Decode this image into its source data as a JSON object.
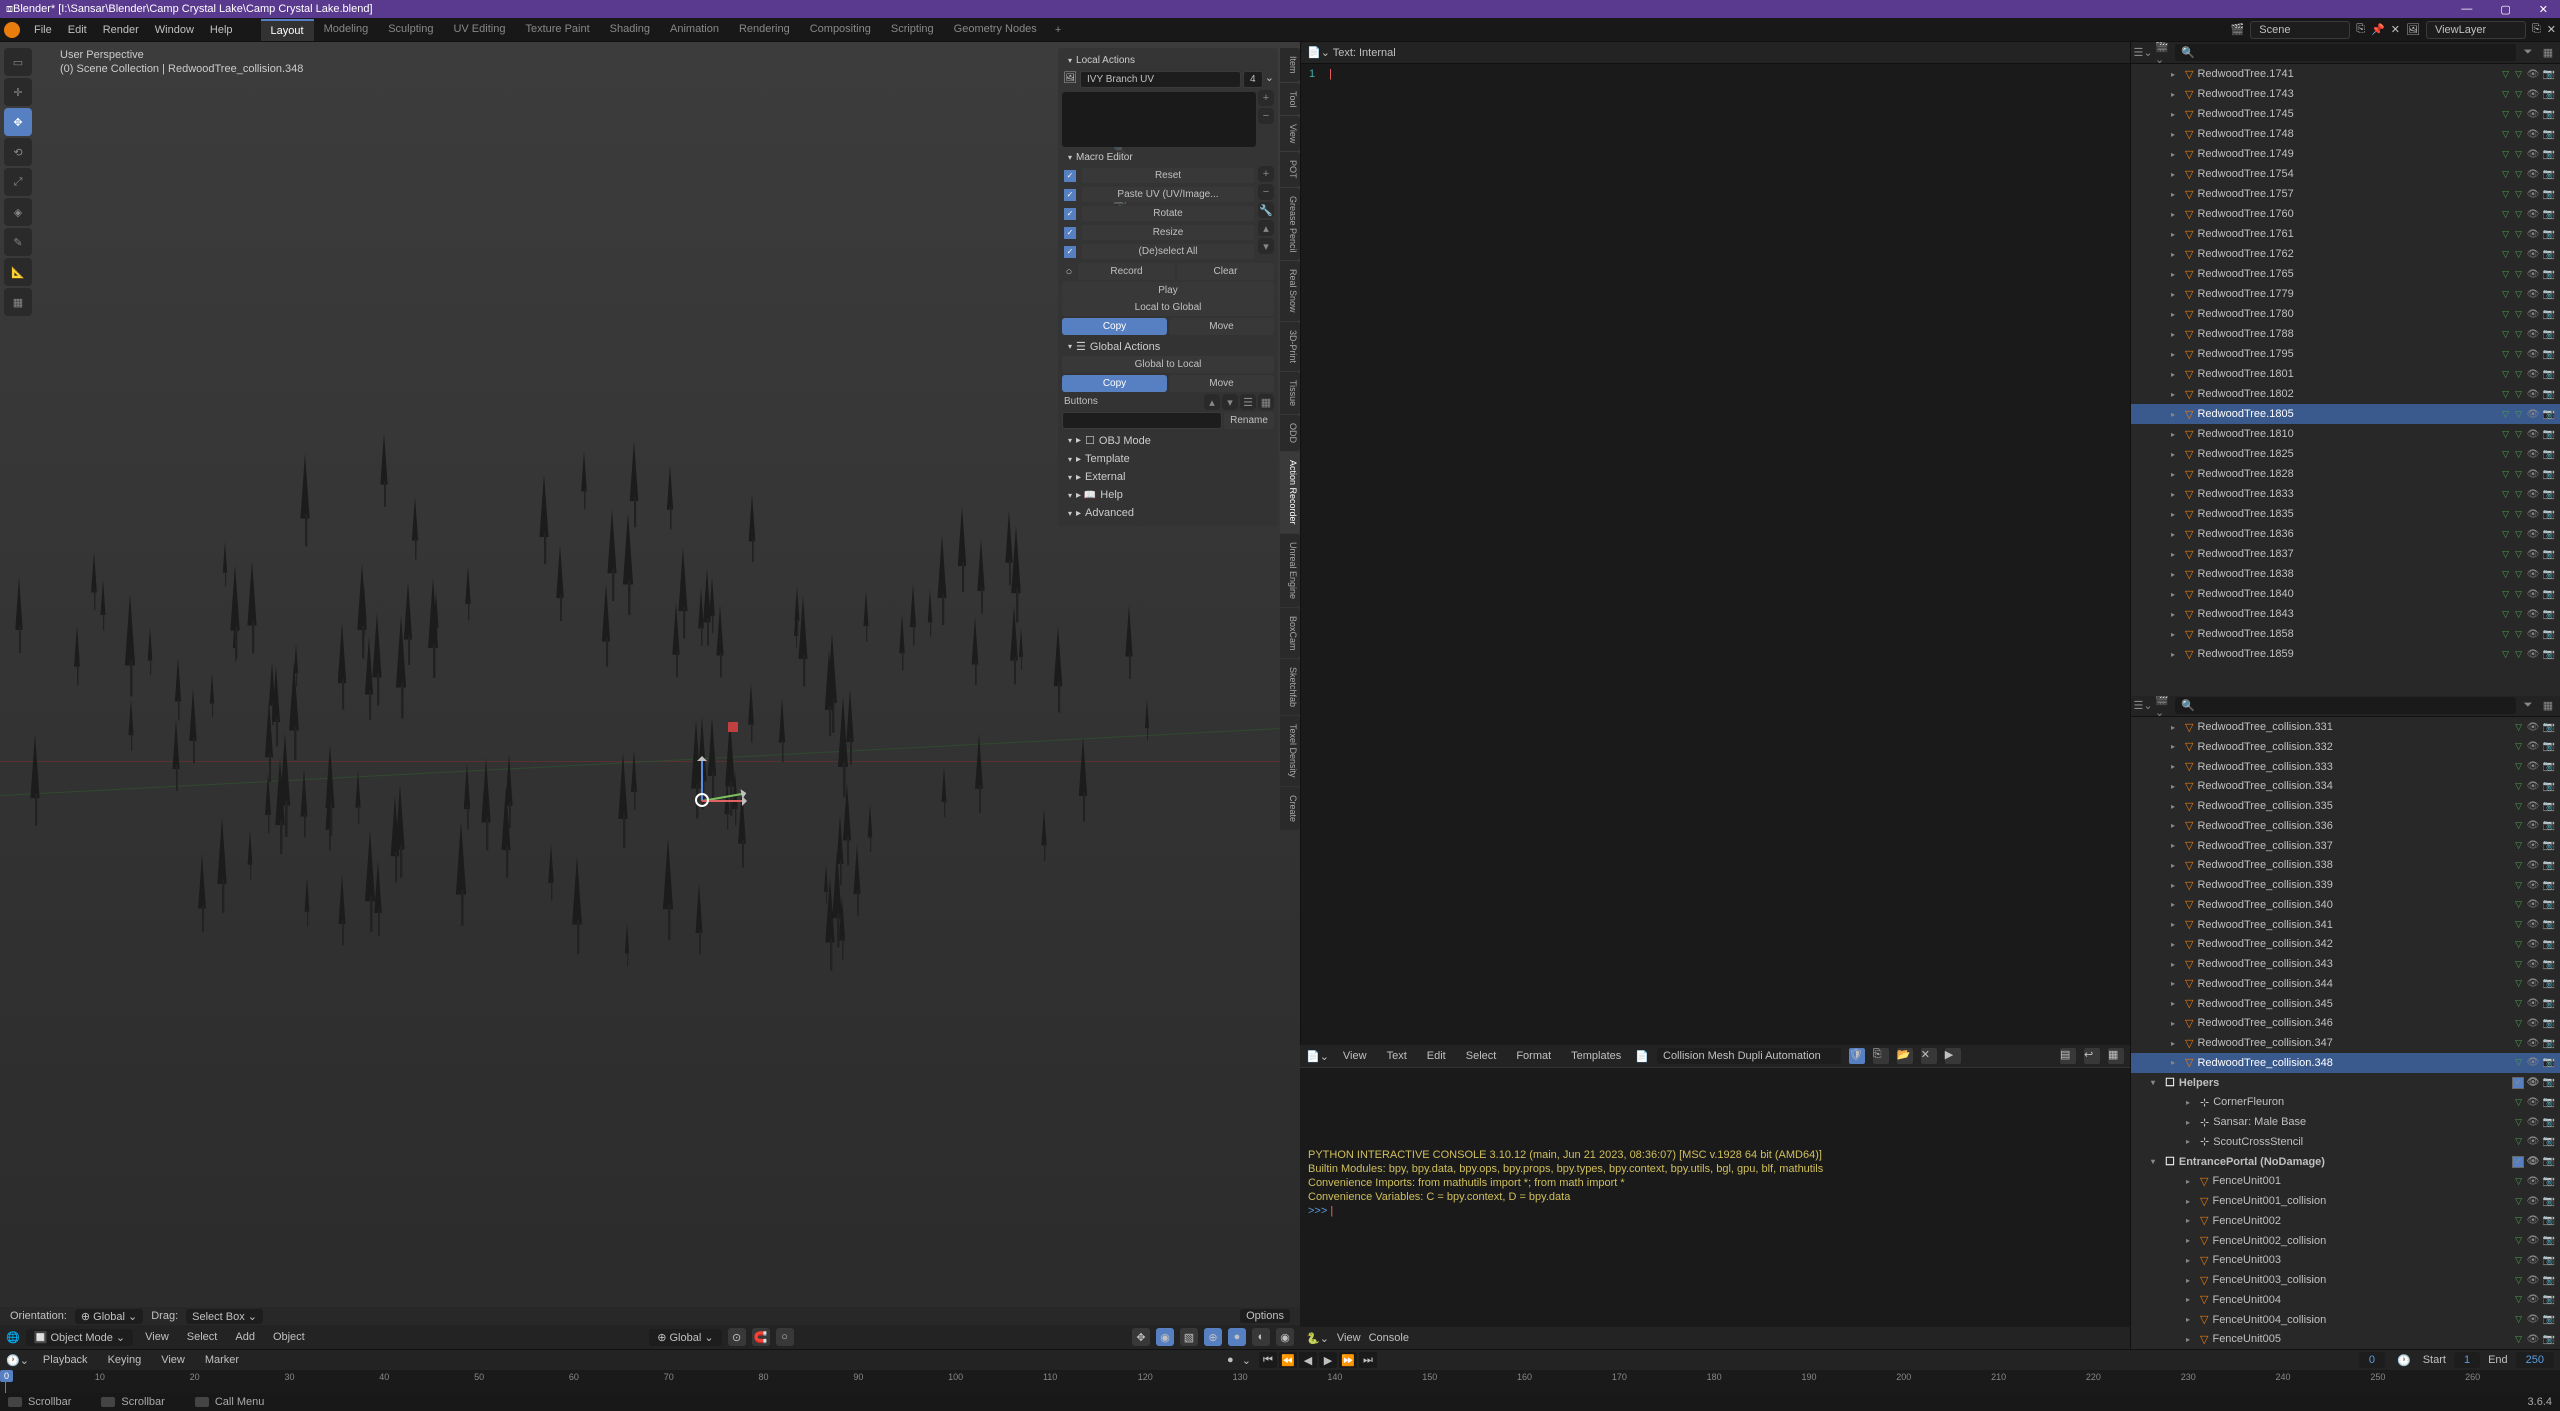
{
  "title_bar": {
    "title": "Blender* [I:\\Sansar\\Blender\\Camp Crystal Lake\\Camp Crystal Lake.blend]"
  },
  "top_menu": {
    "items": [
      "File",
      "Edit",
      "Render",
      "Window",
      "Help"
    ],
    "workspaces": [
      "Layout",
      "Modeling",
      "Sculpting",
      "UV Editing",
      "Texture Paint",
      "Shading",
      "Animation",
      "Rendering",
      "Compositing",
      "Scripting",
      "Geometry Nodes"
    ],
    "active_workspace": 0,
    "scene": "Scene",
    "viewlayer": "ViewLayer"
  },
  "viewport": {
    "info_line1": "User Perspective",
    "info_line2": "(0) Scene Collection | RedwoodTree_collision.348",
    "orientation_label": "Orientation:",
    "orientation_value": "Global",
    "drag_label": "Drag:",
    "drag_value": "Select Box",
    "options_label": "Options",
    "mode": "Object Mode",
    "mode_menus": [
      "View",
      "Select",
      "Add",
      "Object"
    ],
    "global": "Global"
  },
  "n_panel": {
    "local_actions": "Local Actions",
    "macro_editor": "Macro Editor",
    "global_actions": "Global Actions",
    "uv_name": "IVY Branch UV",
    "uv_count": "4",
    "macros": [
      {
        "label": "Reset"
      },
      {
        "label": "Paste UV (UV/Image..."
      },
      {
        "label": "Rotate"
      },
      {
        "label": "Resize"
      },
      {
        "label": "(De)select All"
      }
    ],
    "record": "Record",
    "clear": "Clear",
    "play": "Play",
    "local_to_global": "Local to Global",
    "copy": "Copy",
    "move": "Move",
    "global_to_local": "Global to Local",
    "buttons_label": "Buttons",
    "rename": "Rename",
    "obj_mode": "OBJ Mode",
    "template": "Template",
    "external": "External",
    "help": "Help",
    "advanced": "Advanced",
    "tabs": [
      "Item",
      "Tool",
      "View",
      "POT",
      "Grease Pencil",
      "Real Snow",
      "3D-Print",
      "Tissue",
      "ODD",
      "Action Recorder",
      "Unreal Engine",
      "BoxCam",
      "Sketchfab",
      "Texel Density",
      "Create"
    ]
  },
  "text_editor": {
    "header": "Text: Internal",
    "menus": [
      "View",
      "Text",
      "Edit",
      "Select",
      "Format",
      "Templates"
    ],
    "name": "Collision Mesh Dupli Automation"
  },
  "console": {
    "lines": [
      "PYTHON INTERACTIVE CONSOLE 3.10.12 (main, Jun 21 2023, 08:36:07) [MSC v.1928 64 bit (AMD64)]",
      "",
      "Builtin Modules:       bpy, bpy.data, bpy.ops, bpy.props, bpy.types, bpy.context, bpy.utils, bgl, gpu, blf, mathutils",
      "Convenience Imports:   from mathutils import *; from math import *",
      "Convenience Variables: C = bpy.context, D = bpy.data"
    ],
    "prompt": ">>>",
    "menus": [
      "View",
      "Console"
    ]
  },
  "timeline": {
    "menus": [
      "Playback",
      "Keying",
      "View",
      "Marker"
    ],
    "current": "0",
    "start_label": "Start",
    "start": "1",
    "end_label": "End",
    "end": "250",
    "ticks": [
      "10",
      "20",
      "30",
      "40",
      "50",
      "60",
      "70",
      "80",
      "90",
      "100",
      "110",
      "120",
      "130",
      "140",
      "150",
      "160",
      "170",
      "180",
      "190",
      "200",
      "210",
      "220",
      "230",
      "240",
      "250",
      "260"
    ]
  },
  "status": {
    "scrollbar1": "Scrollbar",
    "scrollbar2": "Scrollbar",
    "callmenu": "Call Menu",
    "version": "3.6.4"
  },
  "outliner_top": {
    "items": [
      {
        "name": "RedwoodTree.1741"
      },
      {
        "name": "RedwoodTree.1743"
      },
      {
        "name": "RedwoodTree.1745"
      },
      {
        "name": "RedwoodTree.1748"
      },
      {
        "name": "RedwoodTree.1749"
      },
      {
        "name": "RedwoodTree.1754"
      },
      {
        "name": "RedwoodTree.1757"
      },
      {
        "name": "RedwoodTree.1760"
      },
      {
        "name": "RedwoodTree.1761"
      },
      {
        "name": "RedwoodTree.1762"
      },
      {
        "name": "RedwoodTree.1765"
      },
      {
        "name": "RedwoodTree.1779"
      },
      {
        "name": "RedwoodTree.1780"
      },
      {
        "name": "RedwoodTree.1788"
      },
      {
        "name": "RedwoodTree.1795"
      },
      {
        "name": "RedwoodTree.1801"
      },
      {
        "name": "RedwoodTree.1802"
      },
      {
        "name": "RedwoodTree.1805",
        "selected": true
      },
      {
        "name": "RedwoodTree.1810"
      },
      {
        "name": "RedwoodTree.1825"
      },
      {
        "name": "RedwoodTree.1828"
      },
      {
        "name": "RedwoodTree.1833"
      },
      {
        "name": "RedwoodTree.1835"
      },
      {
        "name": "RedwoodTree.1836"
      },
      {
        "name": "RedwoodTree.1837"
      },
      {
        "name": "RedwoodTree.1838"
      },
      {
        "name": "RedwoodTree.1840"
      },
      {
        "name": "RedwoodTree.1843"
      },
      {
        "name": "RedwoodTree.1858"
      },
      {
        "name": "RedwoodTree.1859"
      }
    ]
  },
  "outliner_bottom": {
    "items": [
      {
        "name": "RedwoodTree_collision.331"
      },
      {
        "name": "RedwoodTree_collision.332"
      },
      {
        "name": "RedwoodTree_collision.333"
      },
      {
        "name": "RedwoodTree_collision.334"
      },
      {
        "name": "RedwoodTree_collision.335"
      },
      {
        "name": "RedwoodTree_collision.336"
      },
      {
        "name": "RedwoodTree_collision.337"
      },
      {
        "name": "RedwoodTree_collision.338"
      },
      {
        "name": "RedwoodTree_collision.339"
      },
      {
        "name": "RedwoodTree_collision.340"
      },
      {
        "name": "RedwoodTree_collision.341"
      },
      {
        "name": "RedwoodTree_collision.342"
      },
      {
        "name": "RedwoodTree_collision.343"
      },
      {
        "name": "RedwoodTree_collision.344"
      },
      {
        "name": "RedwoodTree_collision.345"
      },
      {
        "name": "RedwoodTree_collision.346"
      },
      {
        "name": "RedwoodTree_collision.347"
      },
      {
        "name": "RedwoodTree_collision.348",
        "selected": true
      }
    ],
    "helpers_label": "Helpers",
    "helpers": [
      {
        "name": "CornerFleuron"
      },
      {
        "name": "Sansar: Male Base"
      },
      {
        "name": "ScoutCrossStencil"
      }
    ],
    "entrance_label": "EntrancePortal (NoDamage)",
    "entrance_items": [
      {
        "name": "FenceUnit001"
      },
      {
        "name": "FenceUnit001_collision"
      },
      {
        "name": "FenceUnit002"
      },
      {
        "name": "FenceUnit002_collision"
      },
      {
        "name": "FenceUnit003"
      },
      {
        "name": "FenceUnit003_collision"
      },
      {
        "name": "FenceUnit004"
      },
      {
        "name": "FenceUnit004_collision"
      },
      {
        "name": "FenceUnit005"
      }
    ]
  }
}
